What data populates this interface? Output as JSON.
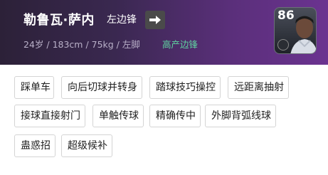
{
  "player": {
    "name": "勒鲁瓦·萨内",
    "position": "左边锋",
    "info": "24岁 / 183cm / 75kg / 左脚",
    "playstyle": "高产边锋",
    "rating": "86"
  },
  "skills": [
    "踩单车",
    "向后切球并转身",
    "踏球技巧操控",
    "远距离抽射",
    "接球直接射门",
    "单触传球",
    "精确传中",
    "外脚背弧线球",
    "蛊惑招",
    "超级候补"
  ]
}
